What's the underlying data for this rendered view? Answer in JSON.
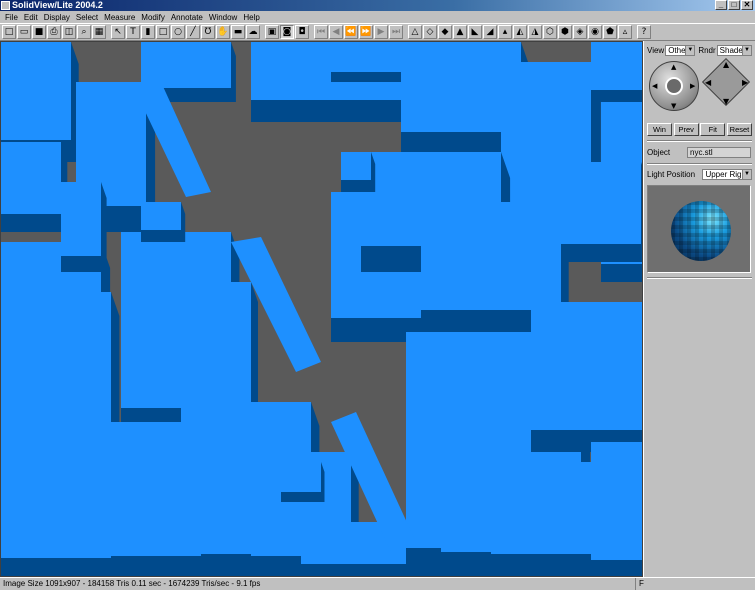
{
  "window": {
    "title": "SolidView/Lite 2004.2",
    "minimize": "_",
    "maximize": "□",
    "close": "✕"
  },
  "menu": [
    "File",
    "Edit",
    "Display",
    "Select",
    "Measure",
    "Modify",
    "Annotate",
    "Window",
    "Help"
  ],
  "toolbar": {
    "buttons": [
      {
        "name": "new-file-icon",
        "glyph": "□"
      },
      {
        "name": "open-folder-icon",
        "glyph": "▭"
      },
      {
        "name": "save-icon",
        "glyph": "■"
      },
      {
        "name": "print-icon",
        "glyph": "⎙"
      },
      {
        "name": "print-preview-icon",
        "glyph": "◫"
      },
      {
        "name": "zoom-icon",
        "glyph": "⌕"
      },
      {
        "name": "render-icon",
        "glyph": "▦"
      },
      {
        "name": "sep"
      },
      {
        "name": "select-arrow-icon",
        "glyph": "↖"
      },
      {
        "name": "text-icon",
        "glyph": "T"
      },
      {
        "name": "highlight-icon",
        "glyph": "▮"
      },
      {
        "name": "rectangle-icon",
        "glyph": "□"
      },
      {
        "name": "ellipse-icon",
        "glyph": "○"
      },
      {
        "name": "line-icon",
        "glyph": "╱"
      },
      {
        "name": "lasso-icon",
        "glyph": "Ʊ"
      },
      {
        "name": "hand-icon",
        "glyph": "✋"
      },
      {
        "name": "eraser-icon",
        "glyph": "▬"
      },
      {
        "name": "cloud-icon",
        "glyph": "☁"
      },
      {
        "name": "sep"
      },
      {
        "name": "camera-icon",
        "glyph": "▣"
      },
      {
        "name": "save-view-icon",
        "glyph": "◙"
      },
      {
        "name": "snapshot-icon",
        "glyph": "◘"
      },
      {
        "name": "sep"
      },
      {
        "name": "first-frame-icon",
        "glyph": "⏮"
      },
      {
        "name": "prev-frame-icon",
        "glyph": "◀"
      },
      {
        "name": "rewind-icon",
        "glyph": "⏪"
      },
      {
        "name": "fast-forward-icon",
        "glyph": "⏩"
      },
      {
        "name": "play-icon",
        "glyph": "▶"
      },
      {
        "name": "last-frame-icon",
        "glyph": "⏭"
      },
      {
        "name": "sep"
      },
      {
        "name": "tool-a-icon",
        "glyph": "△"
      },
      {
        "name": "tool-b-icon",
        "glyph": "◇"
      },
      {
        "name": "tool-c-icon",
        "glyph": "◆"
      },
      {
        "name": "tool-d-icon",
        "glyph": "▲"
      },
      {
        "name": "tool-e-icon",
        "glyph": "◣"
      },
      {
        "name": "tool-f-icon",
        "glyph": "◢"
      },
      {
        "name": "tool-g-icon",
        "glyph": "▴"
      },
      {
        "name": "tool-h-icon",
        "glyph": "◭"
      },
      {
        "name": "tool-i-icon",
        "glyph": "◮"
      },
      {
        "name": "tool-j-icon",
        "glyph": "⬡"
      },
      {
        "name": "tool-k-icon",
        "glyph": "⬢"
      },
      {
        "name": "tool-l-icon",
        "glyph": "◈"
      },
      {
        "name": "tool-m-icon",
        "glyph": "◉"
      },
      {
        "name": "tool-n-icon",
        "glyph": "⬟"
      },
      {
        "name": "tool-o-icon",
        "glyph": "▵"
      },
      {
        "name": "sep"
      },
      {
        "name": "help-icon",
        "glyph": "?"
      }
    ]
  },
  "panel": {
    "view_label": "View",
    "view_value": "Other",
    "rend_label": "Rndr",
    "rend_value": "Shade",
    "buttons": [
      "Win",
      "Prev",
      "Fit",
      "Reset"
    ],
    "object_label": "Object",
    "object_value": "nyc.stl",
    "light_label": "Light Position",
    "light_value": "Upper Right"
  },
  "status": {
    "text": "Image Size 1091x907 - 184158 Tris     0.11 sec - 1674239 Tris/sec - 9.1 fps",
    "flag": "F"
  },
  "colors": {
    "building_top": "#1e90ff",
    "building_side": "#004a8c",
    "street": "#5a5a5a"
  }
}
